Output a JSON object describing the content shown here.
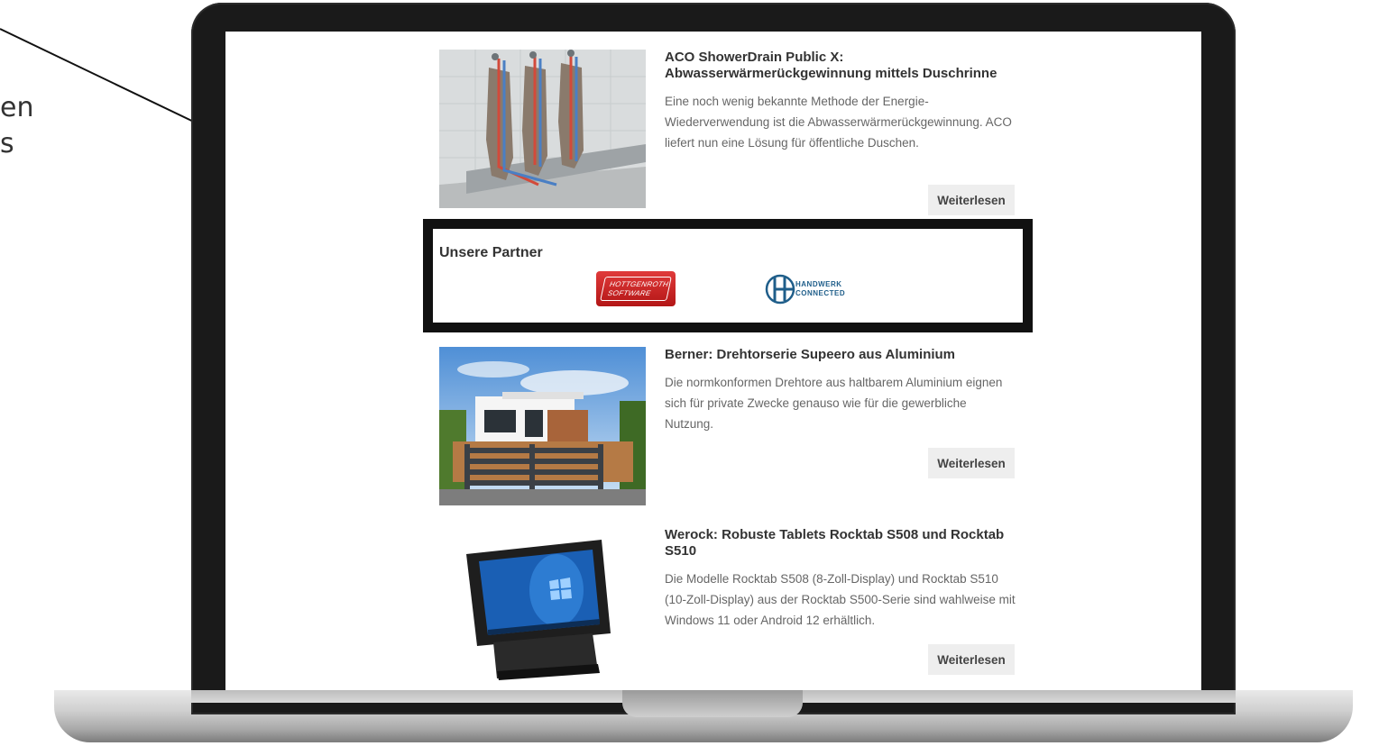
{
  "callout": {
    "text_line1": "en",
    "text_line2": "s"
  },
  "articles": [
    {
      "title": "ACO ShowerDrain Public X: Abwasserwärmerückgewinnung mittels Duschrinne",
      "text": "Eine noch wenig bekannte Methode der Energie-Wiederverwendung ist die Abwasserwärmerückgewinnung. ACO liefert nun eine Lösung für öffentliche Duschen.",
      "button": "Weiterlesen"
    },
    {
      "title": "Berner: Drehtorserie Supeero aus Aluminium",
      "text": "Die normkonformen Drehtore aus haltbarem Aluminium eignen sich für private Zwecke genauso wie für die gewerbliche Nutzung.",
      "button": "Weiterlesen"
    },
    {
      "title": "Werock: Robuste Tablets Rocktab S508 und Rocktab S510",
      "text": "Die Modelle Rocktab S508 (8-Zoll-Display) und Rocktab S510 (10-Zoll-Display) aus der Rocktab S500-Serie sind wahlweise mit Windows 11 oder Android 12 erhältlich.",
      "button": "Weiterlesen"
    }
  ],
  "partners": {
    "title": "Unsere Partner",
    "hottgenroth_line1": "HOTTGENROTH",
    "hottgenroth_line2": "SOFTWARE",
    "handwerk_line1": "HANDWERK",
    "handwerk_line2": "CONNECTED"
  },
  "colors": {
    "highlight_border": "#111111",
    "button_bg": "#eeeeee",
    "hottgenroth_red": "#c62020",
    "handwerk_blue": "#1f5e8a"
  }
}
